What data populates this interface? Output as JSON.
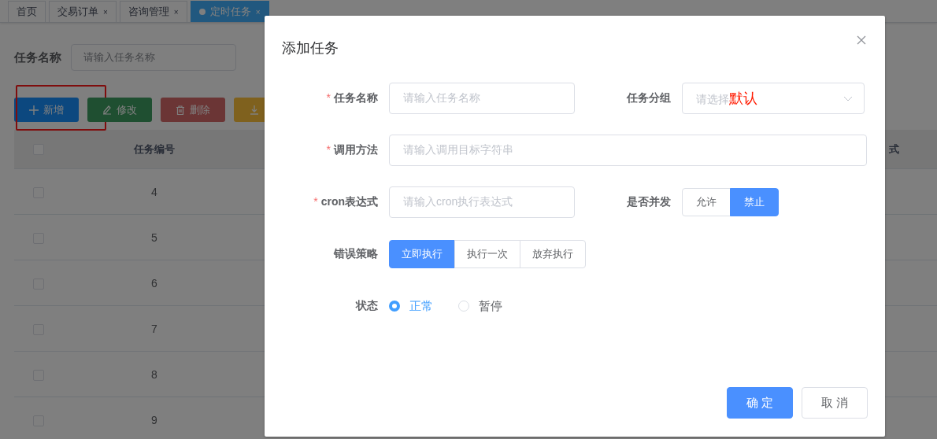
{
  "tabs": [
    {
      "label": "首页",
      "selected": false
    },
    {
      "label": "交易订单",
      "close": "×",
      "selected": false
    },
    {
      "label": "咨询管理",
      "close": "×",
      "selected": false
    },
    {
      "label": "定时任务",
      "close": "×",
      "selected": true
    }
  ],
  "filter": {
    "label": "任务名称",
    "placeholder": "请输入任务名称"
  },
  "toolbar": [
    {
      "kind": "add",
      "label": "新增",
      "annotated": true
    },
    {
      "kind": "edit",
      "label": "修改"
    },
    {
      "kind": "delete",
      "label": "删除"
    },
    {
      "kind": "export"
    }
  ],
  "table": {
    "header_checked": false,
    "columns": [
      "任务编号",
      "式"
    ],
    "rows": [
      {
        "checked": false,
        "id": "4"
      },
      {
        "checked": false,
        "id": "5"
      },
      {
        "checked": false,
        "id": "6"
      },
      {
        "checked": false,
        "id": "7"
      },
      {
        "checked": false,
        "id": "8"
      },
      {
        "checked": false,
        "id": "9"
      }
    ]
  },
  "dialog": {
    "title": "添加任务",
    "rows": [
      {
        "items": [
          {
            "kind": "input",
            "label": "任务名称",
            "required_mark": "*",
            "placeholder": "请输入任务名称"
          },
          {
            "kind": "select",
            "label": "任务分组",
            "placeholder": "请选择",
            "annotation": "默认"
          }
        ]
      },
      {
        "items": [
          {
            "kind": "input",
            "label": "调用方法",
            "required_mark": "*",
            "placeholder": "请输入调用目标字符串"
          }
        ]
      },
      {
        "items": [
          {
            "kind": "input",
            "label": "cron表达式",
            "required_mark": "*",
            "placeholder": "请输入cron执行表达式"
          },
          {
            "kind": "button-group",
            "label": "是否并发",
            "options": [
              {
                "label": "允许",
                "selected": false
              },
              {
                "label": "禁止",
                "selected": true
              }
            ]
          }
        ]
      },
      {
        "items": [
          {
            "kind": "button-group",
            "label": "错误策略",
            "options": [
              {
                "label": "立即执行",
                "selected": true
              },
              {
                "label": "执行一次",
                "selected": false
              },
              {
                "label": "放弃执行",
                "selected": false
              }
            ]
          }
        ]
      },
      {
        "items": [
          {
            "kind": "radio",
            "label": "状态",
            "options": [
              {
                "label": "正常",
                "selected": true
              },
              {
                "label": "暂停",
                "selected": false
              }
            ]
          }
        ]
      }
    ],
    "buttons": [
      {
        "kind": "primary",
        "label": "确 定"
      },
      {
        "kind": "default",
        "label": "取 消"
      }
    ]
  }
}
